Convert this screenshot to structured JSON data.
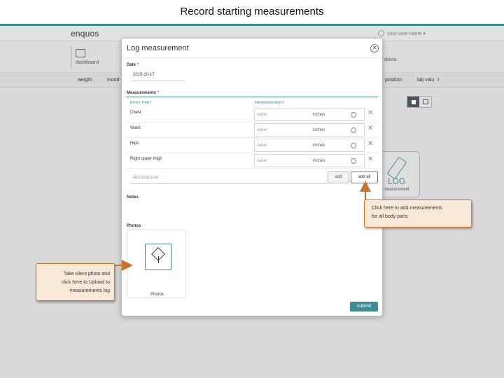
{
  "slide": {
    "title": "Record starting measurements"
  },
  "app": {
    "brand": "enquos",
    "user_menu": "your-user-name ▾",
    "nav": {
      "dashboard": "dashboard",
      "options": "otions"
    },
    "subnav": {
      "weight": "weight",
      "mood": "mood",
      "composition": "position",
      "lab": "lab valu"
    },
    "log_tile": {
      "big": "LOG",
      "sub": "measurement"
    }
  },
  "modal": {
    "title": "Log measurement",
    "date_label": "Date",
    "date_value": "2015-10-17",
    "required_mark": "*",
    "measurements_label": "Measurements",
    "col_body_part": "BODY PART",
    "col_measurement": "MEASUREMENT",
    "rows": [
      {
        "part": "Chest",
        "placeholder": "value",
        "unit": "inches"
      },
      {
        "part": "Waist",
        "placeholder": "value",
        "unit": "inches"
      },
      {
        "part": "Hips",
        "placeholder": "value",
        "unit": "inches"
      },
      {
        "part": "Right upper thigh",
        "placeholder": "value",
        "unit": "inches"
      }
    ],
    "add_body_part_placeholder": "Add body part",
    "add_button": "add",
    "add_all_button": "add all",
    "notes_label": "Notes",
    "photos_label": "Photos",
    "photos_box_label": "Photos",
    "submit_button": "submit"
  },
  "callouts": {
    "right_line1": "Click here to add measurements",
    "right_line2": "for all body parts",
    "left_line1": "Take client photo and",
    "left_line2": "click here to Upload to",
    "left_line3": "measurements log"
  },
  "colors": {
    "accent": "#3d8c93",
    "callout_border": "#c9742d",
    "callout_fill": "#fbe9d8"
  }
}
